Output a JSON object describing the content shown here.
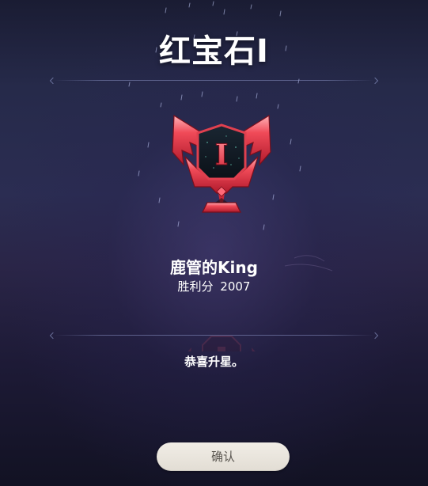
{
  "rank": {
    "title": "红宝石I",
    "tier_numeral": "I",
    "emblem_icon": "ruby-rank-emblem-icon",
    "accent_color": "#e8394a"
  },
  "player": {
    "name": "鹿管的King",
    "score_label": "胜利分",
    "score_value": "2007"
  },
  "message": "恭喜升星。",
  "confirm_button": {
    "label": "确认"
  }
}
